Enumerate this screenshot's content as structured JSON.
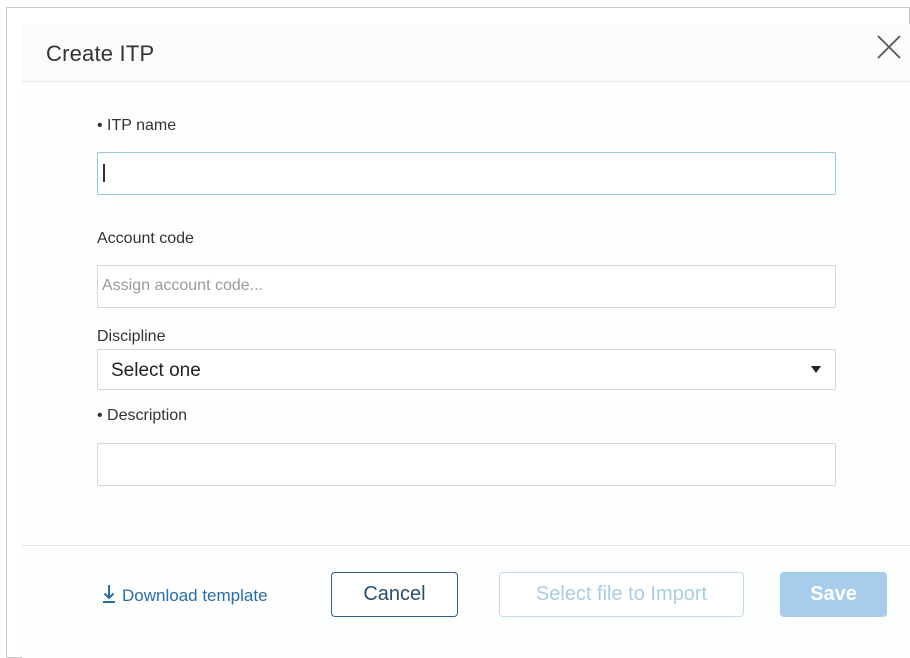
{
  "dialog": {
    "title": "Create ITP"
  },
  "form": {
    "itp_name_label": "• ITP name",
    "itp_name_value": "",
    "account_code_label": "Account code",
    "account_code_placeholder": "Assign account code...",
    "discipline_label": "Discipline",
    "discipline_value": "Select one",
    "description_label": "• Description",
    "description_value": ""
  },
  "footer": {
    "download_label": "Download template",
    "cancel_label": "Cancel",
    "import_label": "Select file to Import",
    "save_label": "Save"
  },
  "colors": {
    "primary": "#2f5f83",
    "link": "#2b6da3",
    "save_disabled": "#a7cdea",
    "import_disabled_text": "#a9cde3"
  },
  "icons": {
    "close": "close-icon",
    "dropdown": "caret-down-icon",
    "download": "download-icon"
  }
}
